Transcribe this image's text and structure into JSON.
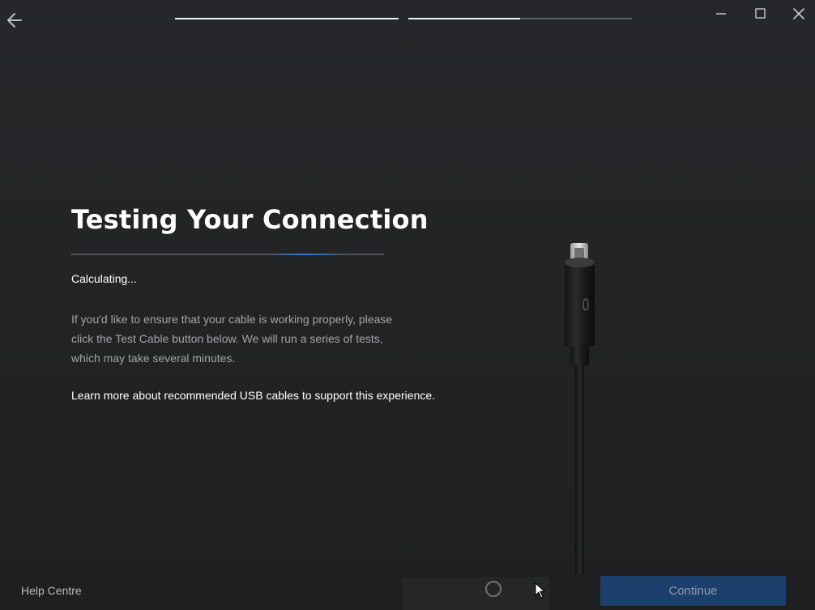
{
  "header": {
    "back_icon": "arrow-left-icon",
    "steps": [
      {
        "progress": 1.0
      },
      {
        "progress": 0.5
      }
    ],
    "window_controls": [
      "minimize-icon",
      "maximize-icon",
      "close-icon"
    ]
  },
  "main": {
    "title": "Testing Your Connection",
    "status": "Calculating...",
    "description": "If you'd like to ensure that your cable is working properly, please click the Test Cable button below. We will run a series of tests, which may take several minutes.",
    "learn_more": "Learn more about recommended USB cables to support this experience.",
    "illustration": "usb-c-cable-illustration"
  },
  "footer": {
    "help_label": "Help Centre",
    "loading_icon": "loading-spinner-icon",
    "continue_label": "Continue"
  },
  "colors": {
    "accent": "#2f7ad6",
    "button_disabled": "#1c3f6b",
    "background": "#232426"
  }
}
